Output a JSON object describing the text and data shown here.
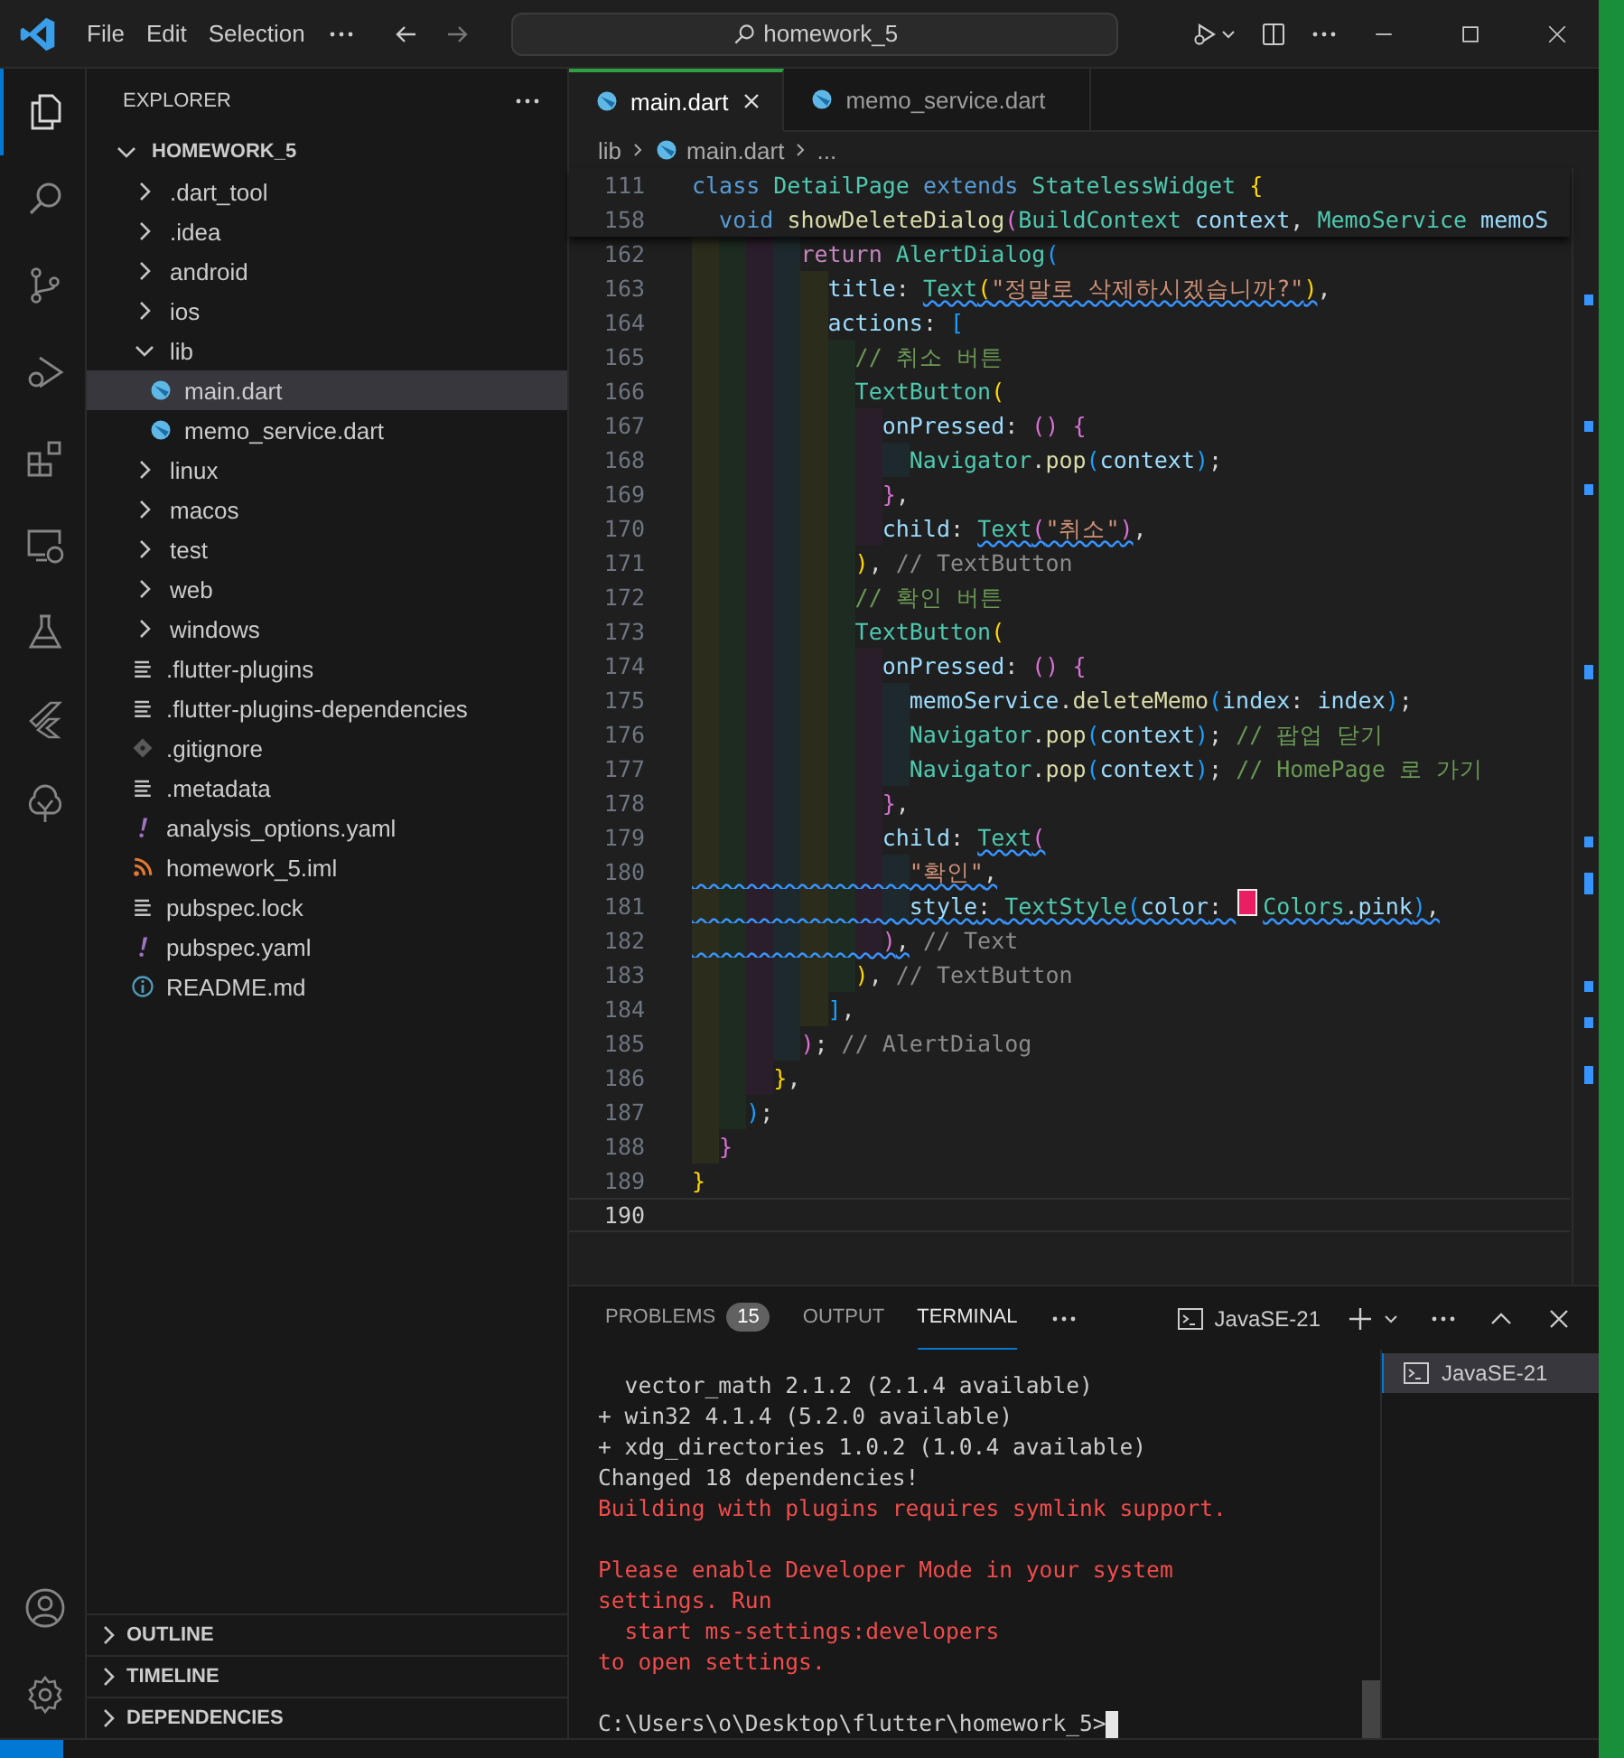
{
  "titlebar": {
    "menu": [
      "File",
      "Edit",
      "Selection"
    ],
    "search": {
      "value": "homework_5"
    }
  },
  "explorer": {
    "title": "EXPLORER",
    "root": {
      "label": "HOMEWORK_5",
      "kind": "folder",
      "expanded": true,
      "selected": false,
      "children": [
        {
          "label": ".dart_tool",
          "kind": "folder",
          "expanded": false,
          "selected": false
        },
        {
          "label": ".idea",
          "kind": "folder",
          "expanded": false,
          "selected": false
        },
        {
          "label": "android",
          "kind": "folder",
          "expanded": false,
          "selected": false
        },
        {
          "label": "ios",
          "kind": "folder",
          "expanded": false,
          "selected": false
        },
        {
          "label": "lib",
          "kind": "folder",
          "expanded": true,
          "selected": false,
          "children": [
            {
              "label": "main.dart",
              "kind": "dart",
              "selected": true
            },
            {
              "label": "memo_service.dart",
              "kind": "dart",
              "selected": false
            }
          ]
        },
        {
          "label": "linux",
          "kind": "folder",
          "expanded": false,
          "selected": false
        },
        {
          "label": "macos",
          "kind": "folder",
          "expanded": false,
          "selected": false
        },
        {
          "label": "test",
          "kind": "folder",
          "expanded": false,
          "selected": false
        },
        {
          "label": "web",
          "kind": "folder",
          "expanded": false,
          "selected": false
        },
        {
          "label": "windows",
          "kind": "folder",
          "expanded": false,
          "selected": false
        },
        {
          "label": ".flutter-plugins",
          "kind": "text",
          "selected": false
        },
        {
          "label": ".flutter-plugins-dependencies",
          "kind": "text",
          "selected": false
        },
        {
          "label": ".gitignore",
          "kind": "git",
          "selected": false
        },
        {
          "label": ".metadata",
          "kind": "text",
          "selected": false
        },
        {
          "label": "analysis_options.yaml",
          "kind": "yaml",
          "selected": false
        },
        {
          "label": "homework_5.iml",
          "kind": "feed",
          "selected": false
        },
        {
          "label": "pubspec.lock",
          "kind": "text",
          "selected": false
        },
        {
          "label": "pubspec.yaml",
          "kind": "yaml",
          "selected": false
        },
        {
          "label": "README.md",
          "kind": "info",
          "selected": false
        }
      ]
    },
    "sections": [
      {
        "label": "OUTLINE",
        "expanded": false
      },
      {
        "label": "TIMELINE",
        "expanded": false
      },
      {
        "label": "DEPENDENCIES",
        "expanded": false
      }
    ]
  },
  "editor": {
    "tabs": [
      {
        "label": "main.dart",
        "selected": true
      },
      {
        "label": "memo_service.dart",
        "selected": false
      }
    ],
    "breadcrumb": [
      "lib",
      "main.dart",
      "..."
    ],
    "sticky": [
      {
        "number": "111",
        "tokens": [
          {
            "text": "class ",
            "kind": "keyword"
          },
          {
            "text": "DetailPage ",
            "kind": "type"
          },
          {
            "text": "extends ",
            "kind": "keyword"
          },
          {
            "text": "StatelessWidget ",
            "kind": "type"
          },
          {
            "text": "{",
            "kind": "bracket1"
          }
        ]
      },
      {
        "number": "158",
        "tokens": [
          {
            "text": "  void ",
            "kind": "keyword"
          },
          {
            "text": "showDeleteDialog",
            "kind": "function"
          },
          {
            "text": "(",
            "kind": "bracket2"
          },
          {
            "text": "BuildContext ",
            "kind": "type"
          },
          {
            "text": "context",
            "kind": "variable"
          },
          {
            "text": ", ",
            "kind": "plain"
          },
          {
            "text": "MemoService ",
            "kind": "type"
          },
          {
            "text": "memoS",
            "kind": "variable"
          }
        ]
      }
    ],
    "lines": [
      {
        "number": "162",
        "tokens": [
          {
            "text": "        return ",
            "kind": "control"
          },
          {
            "text": "AlertDialog",
            "kind": "type"
          },
          {
            "text": "(",
            "kind": "bracket3"
          }
        ]
      },
      {
        "number": "163",
        "tokens": [
          {
            "text": "          title",
            "kind": "variable"
          },
          {
            "text": ": ",
            "kind": "plain"
          },
          {
            "text": "Text",
            "kind": "type",
            "squiggle": true
          },
          {
            "text": "(",
            "kind": "bracket1",
            "squiggle": true
          },
          {
            "text": "\"정말로 삭제하시겠습니까?\"",
            "kind": "string",
            "squiggle": true
          },
          {
            "text": ")",
            "kind": "bracket1",
            "squiggle": true
          },
          {
            "text": ",",
            "kind": "plain"
          }
        ]
      },
      {
        "number": "164",
        "tokens": [
          {
            "text": "          actions",
            "kind": "variable"
          },
          {
            "text": ": ",
            "kind": "plain"
          },
          {
            "text": "[",
            "kind": "bracket3"
          }
        ]
      },
      {
        "number": "165",
        "tokens": [
          {
            "text": "            // 취소 버튼",
            "kind": "comment"
          }
        ]
      },
      {
        "number": "166",
        "tokens": [
          {
            "text": "            TextButton",
            "kind": "type"
          },
          {
            "text": "(",
            "kind": "bracket1"
          }
        ]
      },
      {
        "number": "167",
        "tokens": [
          {
            "text": "              onPressed",
            "kind": "variable"
          },
          {
            "text": ": ",
            "kind": "plain"
          },
          {
            "text": "() {",
            "kind": "bracket2"
          }
        ]
      },
      {
        "number": "168",
        "tokens": [
          {
            "text": "                Navigator",
            "kind": "type"
          },
          {
            "text": ".",
            "kind": "plain"
          },
          {
            "text": "pop",
            "kind": "function"
          },
          {
            "text": "(",
            "kind": "bracket3"
          },
          {
            "text": "context",
            "kind": "variable"
          },
          {
            "text": ")",
            "kind": "bracket3"
          },
          {
            "text": ";",
            "kind": "plain"
          }
        ]
      },
      {
        "number": "169",
        "tokens": [
          {
            "text": "              }",
            "kind": "bracket2"
          },
          {
            "text": ",",
            "kind": "plain"
          }
        ]
      },
      {
        "number": "170",
        "tokens": [
          {
            "text": "              child",
            "kind": "variable"
          },
          {
            "text": ": ",
            "kind": "plain"
          },
          {
            "text": "Text",
            "kind": "type",
            "squiggle": true
          },
          {
            "text": "(",
            "kind": "bracket2",
            "squiggle": true
          },
          {
            "text": "\"취소\"",
            "kind": "string",
            "squiggle": true
          },
          {
            "text": ")",
            "kind": "bracket2",
            "squiggle": true
          },
          {
            "text": ",",
            "kind": "plain"
          }
        ]
      },
      {
        "number": "171",
        "tokens": [
          {
            "text": "            )",
            "kind": "bracket1"
          },
          {
            "text": ", ",
            "kind": "plain"
          },
          {
            "text": "// TextButton",
            "kind": "hint"
          }
        ]
      },
      {
        "number": "172",
        "tokens": [
          {
            "text": "            // 확인 버튼",
            "kind": "comment"
          }
        ]
      },
      {
        "number": "173",
        "tokens": [
          {
            "text": "            TextButton",
            "kind": "type"
          },
          {
            "text": "(",
            "kind": "bracket1"
          }
        ]
      },
      {
        "number": "174",
        "tokens": [
          {
            "text": "              onPressed",
            "kind": "variable"
          },
          {
            "text": ": ",
            "kind": "plain"
          },
          {
            "text": "() {",
            "kind": "bracket2"
          }
        ]
      },
      {
        "number": "175",
        "tokens": [
          {
            "text": "                memoService",
            "kind": "variable"
          },
          {
            "text": ".",
            "kind": "plain"
          },
          {
            "text": "deleteMemo",
            "kind": "function"
          },
          {
            "text": "(",
            "kind": "bracket3"
          },
          {
            "text": "index",
            "kind": "variable"
          },
          {
            "text": ": ",
            "kind": "plain"
          },
          {
            "text": "index",
            "kind": "variable"
          },
          {
            "text": ")",
            "kind": "bracket3"
          },
          {
            "text": ";",
            "kind": "plain"
          }
        ]
      },
      {
        "number": "176",
        "tokens": [
          {
            "text": "                Navigator",
            "kind": "type"
          },
          {
            "text": ".",
            "kind": "plain"
          },
          {
            "text": "pop",
            "kind": "function"
          },
          {
            "text": "(",
            "kind": "bracket3"
          },
          {
            "text": "context",
            "kind": "variable"
          },
          {
            "text": ")",
            "kind": "bracket3"
          },
          {
            "text": "; ",
            "kind": "plain"
          },
          {
            "text": "// 팝업 닫기",
            "kind": "comment"
          }
        ]
      },
      {
        "number": "177",
        "tokens": [
          {
            "text": "                Navigator",
            "kind": "type"
          },
          {
            "text": ".",
            "kind": "plain"
          },
          {
            "text": "pop",
            "kind": "function"
          },
          {
            "text": "(",
            "kind": "bracket3"
          },
          {
            "text": "context",
            "kind": "variable"
          },
          {
            "text": ")",
            "kind": "bracket3"
          },
          {
            "text": "; ",
            "kind": "plain"
          },
          {
            "text": "// HomePage 로 가기",
            "kind": "comment"
          }
        ]
      },
      {
        "number": "178",
        "tokens": [
          {
            "text": "              }",
            "kind": "bracket2"
          },
          {
            "text": ",",
            "kind": "plain"
          }
        ]
      },
      {
        "number": "179",
        "tokens": [
          {
            "text": "              child",
            "kind": "variable"
          },
          {
            "text": ": ",
            "kind": "plain"
          },
          {
            "text": "Text",
            "kind": "type",
            "squiggle": true
          },
          {
            "text": "(",
            "kind": "bracket2",
            "squiggle": true
          }
        ]
      },
      {
        "number": "180",
        "tokens": [
          {
            "text": "                \"확인\"",
            "kind": "string",
            "squiggle": true
          },
          {
            "text": ",",
            "kind": "plain",
            "squiggle": true
          }
        ]
      },
      {
        "number": "181",
        "tokens": [
          {
            "text": "                style",
            "kind": "variable",
            "squiggle": true
          },
          {
            "text": ": ",
            "kind": "plain",
            "squiggle": true
          },
          {
            "text": "TextStyle",
            "kind": "type",
            "squiggle": true
          },
          {
            "text": "(",
            "kind": "bracket3",
            "squiggle": true
          },
          {
            "text": "color",
            "kind": "variable",
            "squiggle": true
          },
          {
            "text": ": ",
            "kind": "plain",
            "squiggle": true
          },
          {
            "kind": "swatch",
            "color": "#e91e63"
          },
          {
            "text": "Colors",
            "kind": "type",
            "squiggle": true
          },
          {
            "text": ".",
            "kind": "plain",
            "squiggle": true
          },
          {
            "text": "pink",
            "kind": "variable",
            "squiggle": true
          },
          {
            "text": ")",
            "kind": "bracket3",
            "squiggle": true
          },
          {
            "text": ",",
            "kind": "plain",
            "squiggle": true
          }
        ]
      },
      {
        "number": "182",
        "tokens": [
          {
            "text": "              )",
            "kind": "bracket2",
            "squiggle": true
          },
          {
            "text": ",",
            "kind": "plain",
            "squiggle": true
          },
          {
            "text": " // Text",
            "kind": "hint"
          }
        ]
      },
      {
        "number": "183",
        "tokens": [
          {
            "text": "            )",
            "kind": "bracket1"
          },
          {
            "text": ", ",
            "kind": "plain"
          },
          {
            "text": "// TextButton",
            "kind": "hint"
          }
        ]
      },
      {
        "number": "184",
        "tokens": [
          {
            "text": "          ]",
            "kind": "bracket3"
          },
          {
            "text": ",",
            "kind": "plain"
          }
        ]
      },
      {
        "number": "185",
        "tokens": [
          {
            "text": "        )",
            "kind": "bracket2"
          },
          {
            "text": "; ",
            "kind": "plain"
          },
          {
            "text": "// AlertDialog",
            "kind": "hint"
          }
        ]
      },
      {
        "number": "186",
        "tokens": [
          {
            "text": "      }",
            "kind": "bracket1"
          },
          {
            "text": ",",
            "kind": "plain"
          }
        ]
      },
      {
        "number": "187",
        "tokens": [
          {
            "text": "    )",
            "kind": "bracket3"
          },
          {
            "text": ";",
            "kind": "plain"
          }
        ]
      },
      {
        "number": "188",
        "tokens": [
          {
            "text": "  }",
            "kind": "bracket2"
          }
        ]
      },
      {
        "number": "189",
        "tokens": [
          {
            "text": "}",
            "kind": "bracket1"
          }
        ]
      },
      {
        "number": "190",
        "current": true
      }
    ]
  },
  "panel": {
    "tabs": [
      {
        "label": "PROBLEMS",
        "badge": "15",
        "selected": false
      },
      {
        "label": "OUTPUT",
        "selected": false
      },
      {
        "label": "TERMINAL",
        "selected": true
      }
    ],
    "terminal_name": "JavaSE-21",
    "lines": [
      {
        "kind": "normal",
        "text": "  vector_math 2.1.2 (2.1.4 available)"
      },
      {
        "kind": "normal",
        "text": "+ win32 4.1.4 (5.2.0 available)"
      },
      {
        "kind": "normal",
        "text": "+ xdg_directories 1.0.2 (1.0.4 available)"
      },
      {
        "kind": "normal",
        "text": "Changed 18 dependencies!"
      },
      {
        "kind": "error",
        "text": "Building with plugins requires symlink support."
      },
      {
        "kind": "blank"
      },
      {
        "kind": "error",
        "text": "Please enable Developer Mode in your system"
      },
      {
        "kind": "error",
        "text": "settings. Run"
      },
      {
        "kind": "error",
        "text": "  start ms-settings:developers"
      },
      {
        "kind": "error",
        "text": "to open settings."
      },
      {
        "kind": "blank"
      },
      {
        "kind": "prompt",
        "text": "C:\\Users\\o\\Desktop\\flutter\\homework_5>"
      }
    ],
    "terminals": [
      {
        "label": "JavaSE-21",
        "selected": true
      }
    ]
  }
}
